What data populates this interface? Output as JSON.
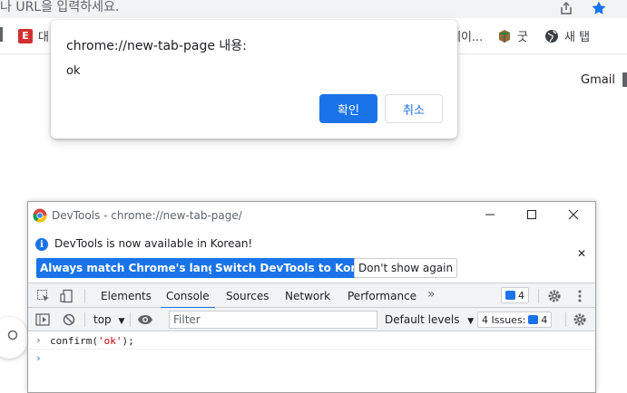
{
  "browser": {
    "omnibox_text": "나 URL을 입력하세요.",
    "bookmarks": [
      {
        "label": "대",
        "icon": "e-logo-icon"
      },
      {
        "label": "게이...",
        "icon": "none"
      },
      {
        "label": "굿",
        "icon": "cube-icon"
      },
      {
        "label": "새 탭",
        "icon": "globe-icon"
      }
    ],
    "gmail": "Gmail"
  },
  "dialog": {
    "title": "chrome://new-tab-page 내용:",
    "message": "ok",
    "ok_label": "확인",
    "cancel_label": "취소"
  },
  "devtools": {
    "window_title": "DevTools - chrome://new-tab-page/",
    "info_message": "DevTools is now available in Korean!",
    "btn_match": "Always match Chrome's language",
    "btn_switch": "Switch DevTools to Korean",
    "btn_dont_show": "Don't show again",
    "tabs": [
      "Elements",
      "Console",
      "Sources",
      "Network",
      "Performance"
    ],
    "active_tab": "Console",
    "more_tabs": "»",
    "messages_count": "4",
    "context": "top",
    "filter_placeholder": "Filter",
    "levels": "Default levels",
    "issues_label": "4 Issues:",
    "issues_count": "4",
    "console_input": {
      "prefix": "confirm(",
      "arg": "'ok'",
      "suffix": ");"
    },
    "colors": {
      "accent": "#1a73e8",
      "string": "#c80000"
    }
  }
}
